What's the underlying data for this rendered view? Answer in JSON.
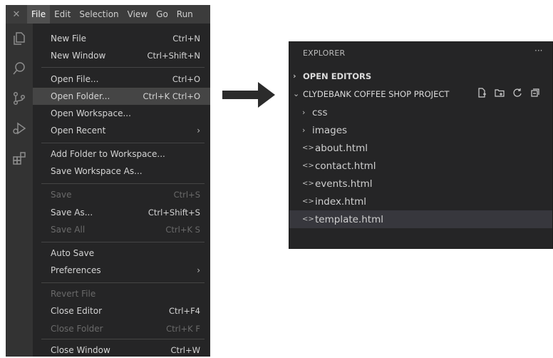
{
  "menubar": {
    "items": [
      "File",
      "Edit",
      "Selection",
      "View",
      "Go",
      "Run"
    ]
  },
  "file_menu": {
    "items": [
      {
        "label": "New File",
        "shortcut": "Ctrl+N"
      },
      {
        "label": "New Window",
        "shortcut": "Ctrl+Shift+N"
      },
      {
        "label": "Open File...",
        "shortcut": "Ctrl+O"
      },
      {
        "label": "Open Folder...",
        "shortcut": "Ctrl+K Ctrl+O"
      },
      {
        "label": "Open Workspace...",
        "shortcut": ""
      },
      {
        "label": "Open Recent",
        "submenu": "›"
      },
      {
        "label": "Add Folder to Workspace...",
        "shortcut": ""
      },
      {
        "label": "Save Workspace As...",
        "shortcut": ""
      },
      {
        "label": "Save",
        "shortcut": "Ctrl+S"
      },
      {
        "label": "Save As...",
        "shortcut": "Ctrl+Shift+S"
      },
      {
        "label": "Save All",
        "shortcut": "Ctrl+K S"
      },
      {
        "label": "Auto Save",
        "shortcut": ""
      },
      {
        "label": "Preferences",
        "submenu": "›"
      },
      {
        "label": "Revert File",
        "shortcut": ""
      },
      {
        "label": "Close Editor",
        "shortcut": "Ctrl+F4"
      },
      {
        "label": "Close Folder",
        "shortcut": "Ctrl+K F"
      },
      {
        "label": "Close Window",
        "shortcut": "Ctrl+W"
      }
    ]
  },
  "explorer": {
    "title": "EXPLORER",
    "more": "···",
    "open_editors": "OPEN EDITORS",
    "project": "CLYDEBANK COFFEE SHOP PROJECT",
    "folders": [
      "css",
      "images"
    ],
    "files": [
      "about.html",
      "contact.html",
      "events.html",
      "index.html",
      "template.html"
    ]
  },
  "glyphs": {
    "chevron_right": "›",
    "chevron_down": "⌄",
    "file_code": "<>"
  },
  "colors": {
    "menu_bg": "#252526",
    "highlight": "#454545",
    "titlebar": "#3c3c3c",
    "activity_bar": "#333333"
  }
}
